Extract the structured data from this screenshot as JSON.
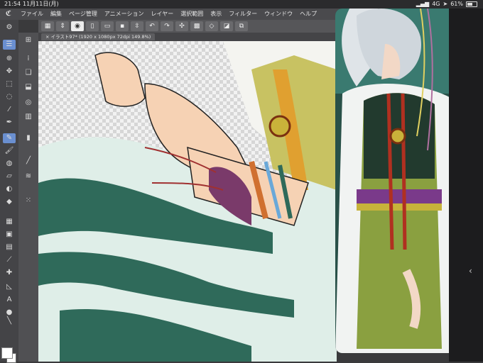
{
  "status": {
    "time": "21:54",
    "date": "11月11日(月)",
    "network": "4G",
    "battery": "61%",
    "battery_level": 0.61
  },
  "menu": {
    "items": [
      "ファイル",
      "編集",
      "ページ管理",
      "アニメーション",
      "レイヤー",
      "選択範囲",
      "表示",
      "フィルター",
      "ウィンドウ",
      "ヘルプ"
    ]
  },
  "document": {
    "tab_title": "イラスト97* (1920 x 1080px 72dpi 149.8%)"
  },
  "colors": {
    "main": "#ffffff",
    "sub": "#ffffff",
    "accent": "#6a8fd0"
  }
}
